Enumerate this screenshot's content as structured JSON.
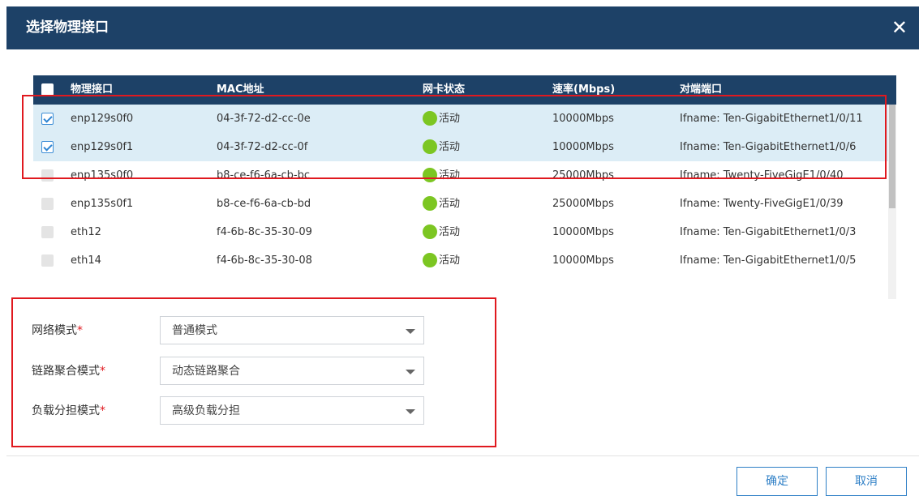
{
  "dialog": {
    "title": "选择物理接口"
  },
  "table": {
    "headers": {
      "interface": "物理接口",
      "mac": "MAC地址",
      "status": "网卡状态",
      "speed": "速率(Mbps)",
      "peer": "对端端口"
    },
    "rows": [
      {
        "checked": true,
        "interface": "enp129s0f0",
        "mac": "04-3f-72-d2-cc-0e",
        "status": "活动",
        "speed": "10000Mbps",
        "peer": "Ifname: Ten-GigabitEthernet1/0/11"
      },
      {
        "checked": true,
        "interface": "enp129s0f1",
        "mac": "04-3f-72-d2-cc-0f",
        "status": "活动",
        "speed": "10000Mbps",
        "peer": "Ifname: Ten-GigabitEthernet1/0/6"
      },
      {
        "checked": false,
        "interface": "enp135s0f0",
        "mac": "b8-ce-f6-6a-cb-bc",
        "status": "活动",
        "speed": "25000Mbps",
        "peer": "Ifname: Twenty-FiveGigE1/0/40"
      },
      {
        "checked": false,
        "interface": "enp135s0f1",
        "mac": "b8-ce-f6-6a-cb-bd",
        "status": "活动",
        "speed": "25000Mbps",
        "peer": "Ifname: Twenty-FiveGigE1/0/39"
      },
      {
        "checked": false,
        "interface": "eth12",
        "mac": "f4-6b-8c-35-30-09",
        "status": "活动",
        "speed": "10000Mbps",
        "peer": "Ifname: Ten-GigabitEthernet1/0/3"
      },
      {
        "checked": false,
        "interface": "eth14",
        "mac": "f4-6b-8c-35-30-08",
        "status": "活动",
        "speed": "10000Mbps",
        "peer": "Ifname: Ten-GigabitEthernet1/0/5"
      }
    ]
  },
  "form": {
    "network_mode": {
      "label": "网络模式",
      "required": "*",
      "value": "普通模式"
    },
    "link_aggregation": {
      "label": "链路聚合模式",
      "required": "*",
      "value": "动态链路聚合"
    },
    "load_sharing": {
      "label": "负载分担模式",
      "required": "*",
      "value": "高级负载分担"
    }
  },
  "buttons": {
    "confirm": "确定",
    "cancel": "取消"
  },
  "colors": {
    "header": "#1d4167",
    "selected_row": "#dcedf6",
    "status_active": "#7cc622",
    "annotation": "#e0191f",
    "button": "#2e7fc6"
  },
  "icons": {
    "close": "close-icon",
    "caret": "chevron-down-icon"
  }
}
